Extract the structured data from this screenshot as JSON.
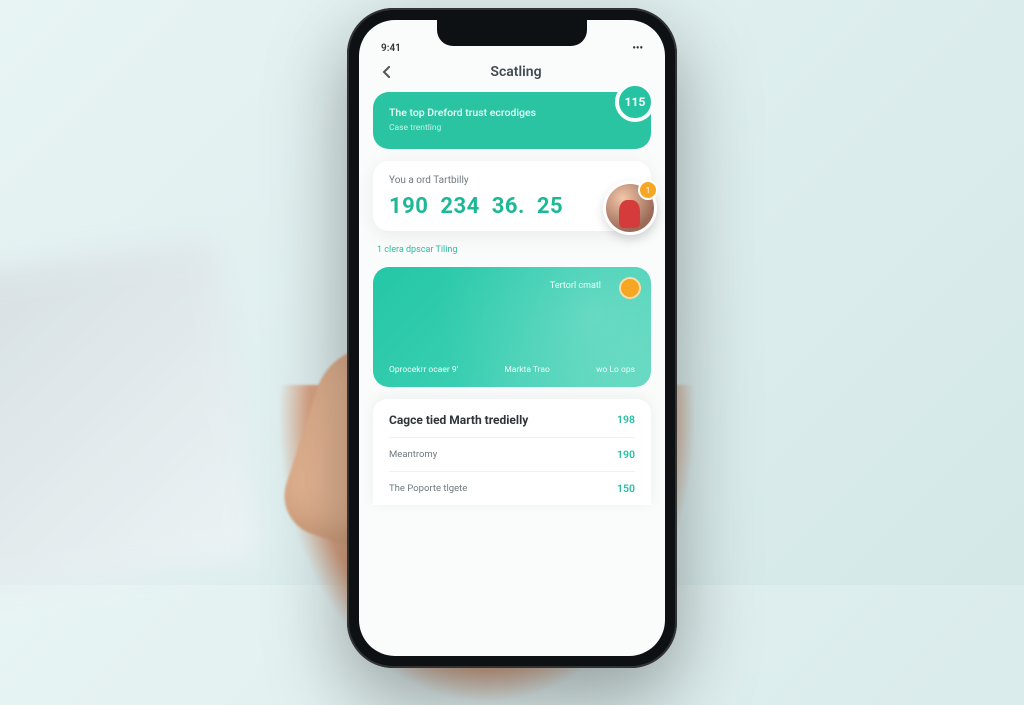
{
  "status_bar": {
    "left": "9:41",
    "right": "•••"
  },
  "header": {
    "title": "Scatling"
  },
  "hero": {
    "title": "The top Dreford trust ecrodiges",
    "subtitle": "Case trentling",
    "badge": "115"
  },
  "stats": {
    "label": "You a ord Tartbilly",
    "values": [
      "190",
      "234",
      "36.",
      "25"
    ],
    "avatar_badge": "1"
  },
  "section_subtitle": "1 clera dpscar Tiling",
  "wave": {
    "top_label": "Tertorl cmatl",
    "items": [
      "Oprocekrr ocaer 9'",
      "Markta Trao",
      "wo Lo ops"
    ]
  },
  "list": {
    "title": "Cagce tied Marth tredielly",
    "top_value": "198",
    "rows": [
      {
        "label": "Meantromy",
        "value": "190"
      },
      {
        "label": "The Poporte tlgete",
        "value": "150"
      }
    ]
  }
}
